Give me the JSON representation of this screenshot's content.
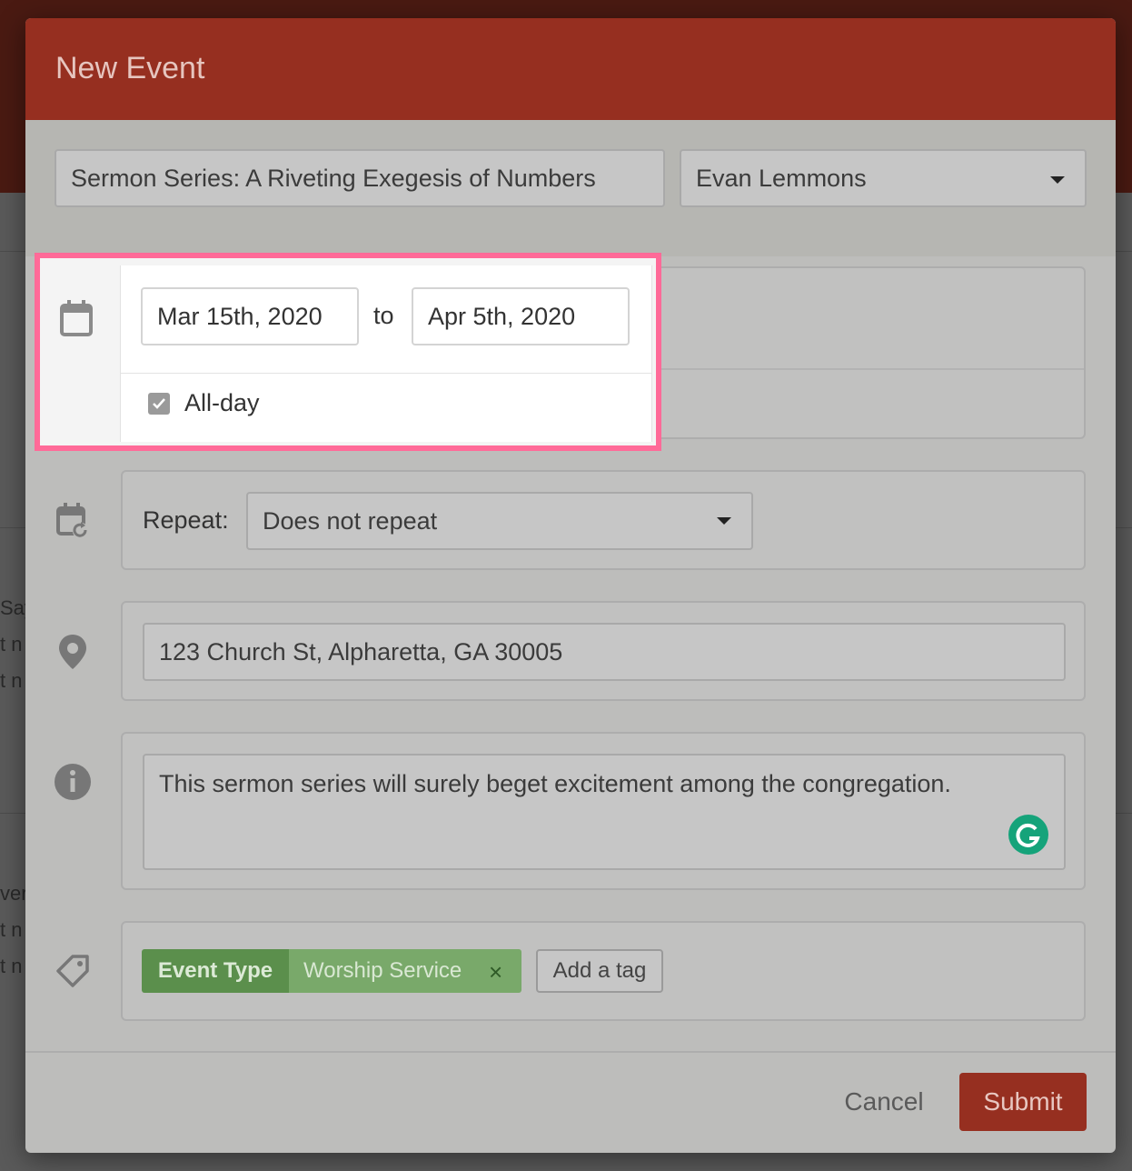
{
  "modal": {
    "title": "New Event"
  },
  "event": {
    "title_value": "Sermon Series: A Riveting Exegesis of Numbers",
    "owner_value": "Evan Lemmons"
  },
  "dates": {
    "start_value": "Mar 15th, 2020",
    "separator": "to",
    "end_value": "Apr 5th, 2020",
    "all_day_label": "All-day",
    "all_day_checked": true
  },
  "repeat": {
    "label": "Repeat:",
    "value": "Does not repeat"
  },
  "location": {
    "value": "123 Church St, Alpharetta, GA 30005"
  },
  "description": {
    "value": "This sermon series will surely beget excitement among the congregation."
  },
  "tags": {
    "items": [
      {
        "key": "Event Type",
        "value": "Worship Service",
        "remove": "×"
      }
    ],
    "add_label": "Add a tag"
  },
  "footer": {
    "cancel_label": "Cancel",
    "submit_label": "Submit"
  },
  "colors": {
    "header": "#962f20",
    "highlight_border": "#ff6a98",
    "tag_key": "#5b8f4c",
    "tag_value": "#79a96a",
    "grammarly": "#15a37a"
  },
  "icons": [
    "calendar-icon",
    "calendar-repeat-icon",
    "location-pin-icon",
    "info-icon",
    "tag-icon",
    "grammarly-icon",
    "dropdown-caret-icon",
    "checkbox-checked-icon"
  ],
  "background": {
    "fragments": [
      "Say",
      "t n",
      "t n",
      "ver",
      "t n",
      "t n"
    ]
  }
}
